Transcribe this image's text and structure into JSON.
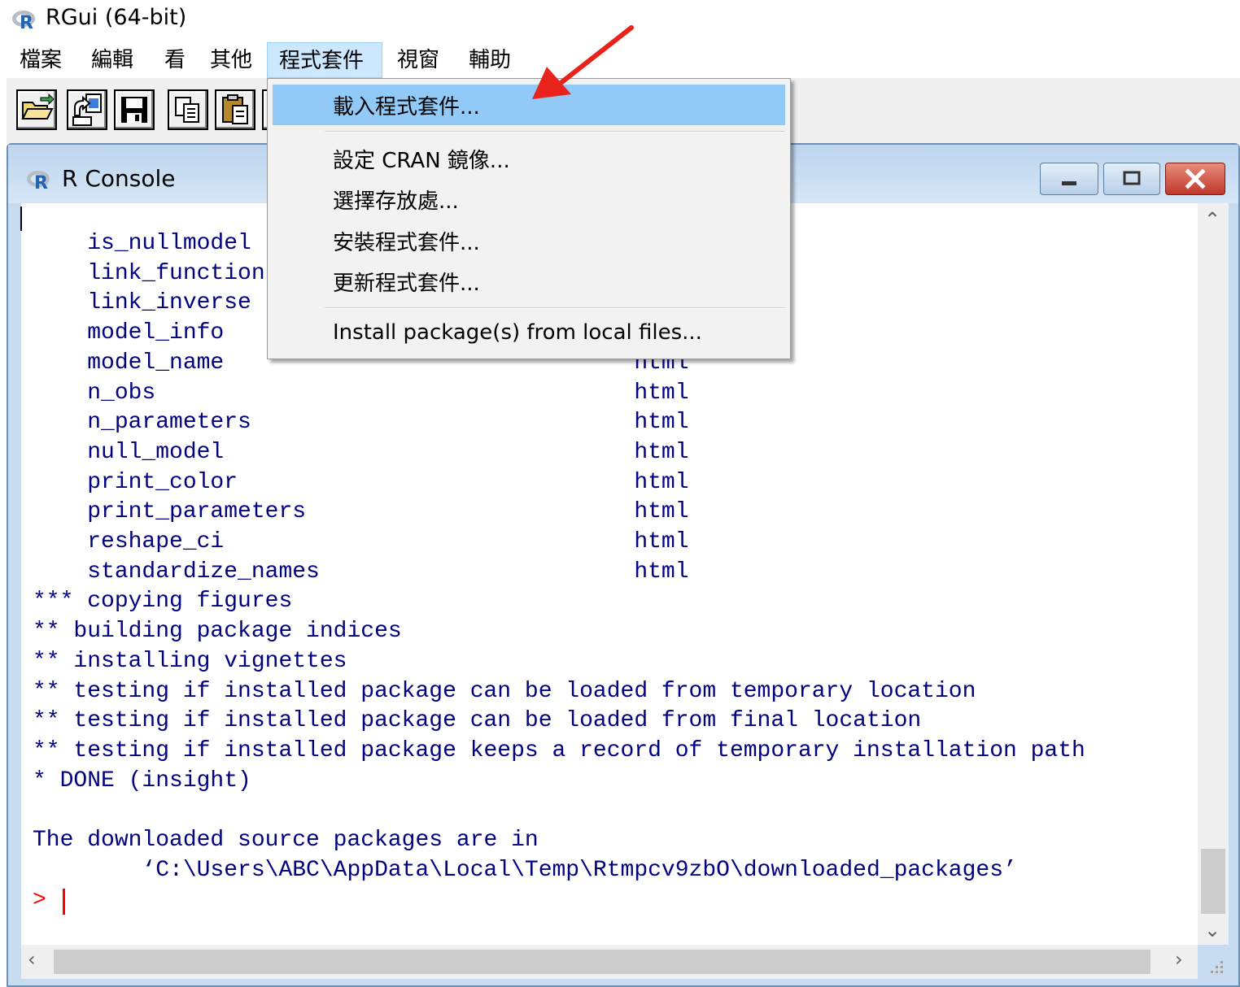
{
  "window": {
    "title": "RGui (64-bit)"
  },
  "menubar": {
    "items": [
      {
        "label": "檔案"
      },
      {
        "label": "編輯"
      },
      {
        "label": "看"
      },
      {
        "label": "其他"
      },
      {
        "label": "程式套件"
      },
      {
        "label": "視窗"
      },
      {
        "label": "輔助"
      }
    ],
    "active_index": 4
  },
  "toolbar": {
    "buttons": [
      "open-script-icon",
      "load-workspace-icon",
      "save-icon",
      "copy-icon",
      "paste-icon"
    ]
  },
  "package_menu": {
    "items": [
      {
        "label": "載入程式套件..."
      },
      {
        "label": "設定 CRAN 鏡像..."
      },
      {
        "label": "選擇存放處..."
      },
      {
        "label": "安裝程式套件..."
      },
      {
        "label": "更新程式套件..."
      },
      {
        "label": "Install package(s) from local files..."
      }
    ],
    "highlighted_index": 0
  },
  "console": {
    "title": "R Console",
    "lines": "    is_nullmodel                            html\n    link_function                           html\n    link_inverse                            html\n    model_info                              html\n    model_name                              html\n    n_obs                                   html\n    n_parameters                            html\n    null_model                              html\n    print_color                             html\n    print_parameters                        html\n    reshape_ci                              html\n    standardize_names                       html\n*** copying figures\n** building package indices\n** installing vignettes\n** testing if installed package can be loaded from temporary location\n** testing if installed package can be loaded from final location\n** testing if installed package keeps a record of temporary installation path\n* DONE (insight)\n\nThe downloaded source packages are in\n        ‘C:\\Users\\ABC\\AppData\\Local\\Temp\\Rtmpcv9zbO\\downloaded_packages’",
    "prompt": ">"
  },
  "colors": {
    "console_text": "#000080",
    "prompt": "#ff0000",
    "menu_highlight": "#91c9f7",
    "annotation_arrow": "#e8231b"
  }
}
